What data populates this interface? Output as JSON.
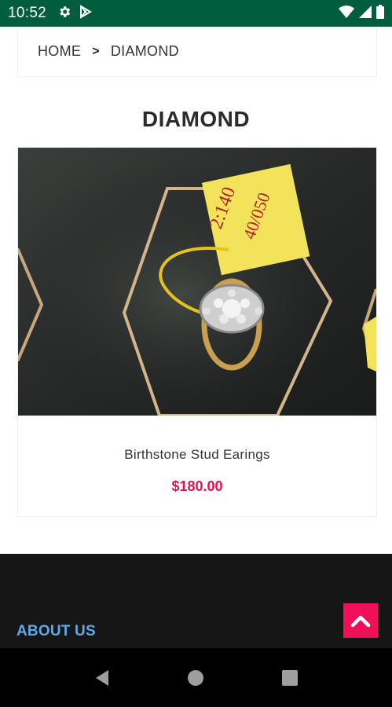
{
  "status_bar": {
    "time": "10:52",
    "left_icons": [
      "gear-icon",
      "play-store-icon"
    ],
    "right_icons": [
      "wifi-icon",
      "cell-signal-icon",
      "battery-icon"
    ]
  },
  "breadcrumb": {
    "home": "HOME",
    "separator": ">",
    "current": "DIAMOND"
  },
  "page": {
    "title": "DIAMOND"
  },
  "product": {
    "name": "Birthstone Stud Earings",
    "price": "$180.00",
    "tag_text_1": "2:140",
    "tag_text_2": "40/050"
  },
  "footer": {
    "about_label": "ABOUT US"
  },
  "colors": {
    "status_bar": "#005e3f",
    "price": "#e8104a",
    "scroll_top": "#f0105a",
    "about_link": "#5ea9e8",
    "footer_bg": "#161616"
  },
  "nav": {
    "icons": [
      "back-icon",
      "home-icon",
      "recents-icon"
    ]
  }
}
